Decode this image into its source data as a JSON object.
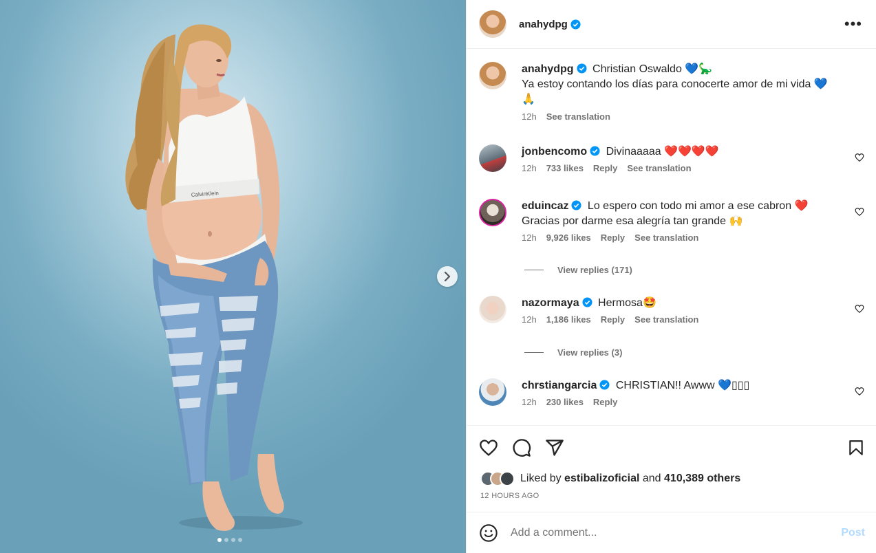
{
  "post": {
    "author": "anahydpg",
    "more_label": "•••",
    "next_label": "›",
    "caption": {
      "author": "anahydpg",
      "line1": "Christian Oswaldo 💙🦕",
      "line2": "Ya estoy contando los días para conocerte amor de mi vida 💙",
      "line3": "🙏",
      "time": "12h",
      "translate": "See translation"
    }
  },
  "comments": [
    {
      "user": "jonbencomo",
      "text": "Divinaaaaa ❤️❤️❤️❤️",
      "text2": "",
      "time": "12h",
      "likes": "733 likes",
      "reply": "Reply",
      "translate": "See translation"
    },
    {
      "user": "eduincaz",
      "text": "Lo espero con todo mi amor a ese cabron ❤️",
      "text2": "Gracias por darme esa alegría tan grande 🙌",
      "time": "12h",
      "likes": "9,926 likes",
      "reply": "Reply",
      "translate": "See translation",
      "view_replies": "View replies (171)"
    },
    {
      "user": "nazormaya",
      "text": "Hermosa🤩",
      "text2": "",
      "time": "12h",
      "likes": "1,186 likes",
      "reply": "Reply",
      "translate": "See translation",
      "view_replies": "View replies (3)"
    },
    {
      "user": "chrstiangarcia",
      "text": "CHRISTIAN!! Awww 💙▯▯▯",
      "text2": "",
      "time": "12h",
      "likes": "230 likes",
      "reply": "Reply",
      "translate": ""
    }
  ],
  "likes": {
    "prefix": "Liked by",
    "user": "estibalizoficial",
    "and": "and",
    "others": "410,389 others"
  },
  "timestamp": "12 HOURS AGO",
  "add_comment": {
    "placeholder": "Add a comment...",
    "post_label": "Post"
  },
  "colors": {
    "verified": "#0095f6",
    "post_disabled": "#b3dbff",
    "secondary_text": "#737373"
  }
}
